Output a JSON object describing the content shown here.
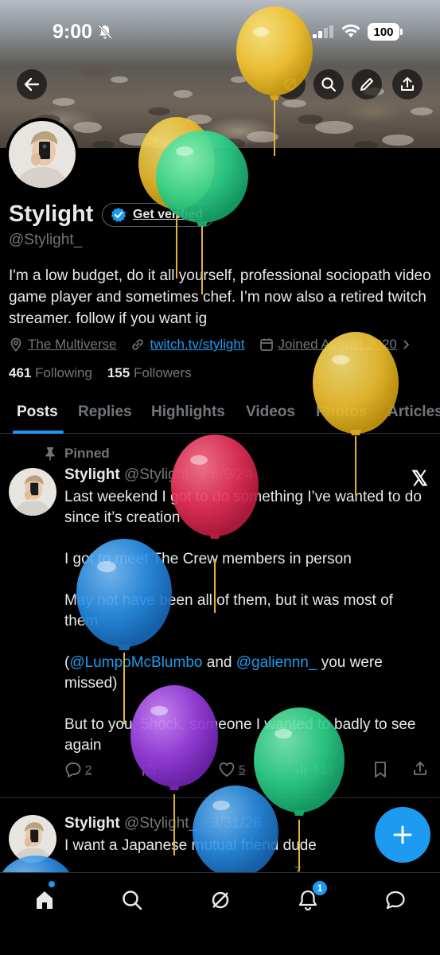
{
  "status_bar": {
    "time": "9:00",
    "battery": "100"
  },
  "profile": {
    "name": "Stylight",
    "verify_label": "Get verified",
    "handle": "@Stylight_",
    "bio": "I'm a low budget, do it all yourself, professional sociopath video game player and sometimes chef. I’m now also a retired twitch streamer. follow if you want ig",
    "location": "The Multiverse",
    "website": "twitch.tv/stylight",
    "joined": "Joined August 2020",
    "following_count": "461",
    "following_label": "Following",
    "followers_count": "155",
    "followers_label": "Followers"
  },
  "tabs": [
    "Posts",
    "Replies",
    "Highlights",
    "Videos",
    "Photos",
    "Articles"
  ],
  "posts": [
    {
      "pinned_label": "Pinned",
      "author": "Stylight",
      "handle_date": "@Stylight_ · 6/9/24",
      "paragraphs": [
        "Last weekend I got to do something I’ve wanted to do since it’s creation",
        "I got to meet The Crew members in person",
        "May not have been all of them, but it was most of them"
      ],
      "mention_1": "@LumpoMcBlumbo",
      "mention_mid": " and ",
      "mention_2": "@galiennn_",
      "mention_tail": " you were missed)",
      "open_paren": "(",
      "last_paragraph": "But to you, 5hock, someone I wanted to badly to see again",
      "replies": "2",
      "likes": "5",
      "views": "614"
    },
    {
      "author": "Stylight",
      "handle_date": "@Stylight_ · 3/31/26",
      "text": "I want a Japanese mutual friend dude",
      "views": "7"
    }
  ],
  "nav": {
    "notification_count": "1"
  },
  "icons": [
    "back-arrow-icon",
    "grok-icon",
    "search-icon",
    "pen-icon",
    "share-icon",
    "location-icon",
    "link-icon",
    "calendar-icon",
    "pin-icon",
    "x-logo-icon",
    "reply-icon",
    "repost-icon",
    "like-icon",
    "views-icon",
    "bookmark-icon",
    "home-icon",
    "bell-icon",
    "messages-icon",
    "plus-icon"
  ],
  "colors": {
    "accent": "#1d9bf0",
    "background": "#000000",
    "secondary_text": "#71767b"
  }
}
